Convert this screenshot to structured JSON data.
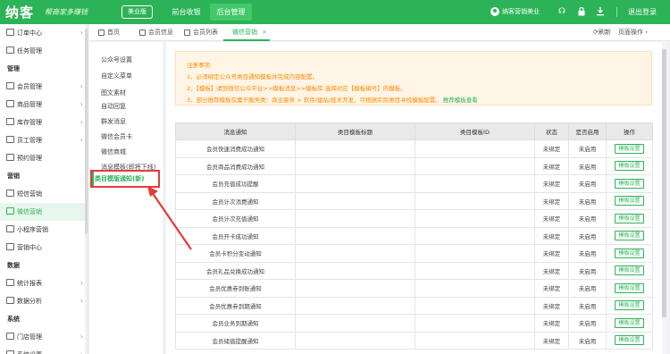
{
  "header": {
    "logo": "纳客",
    "slogan": "帮商家多赚钱",
    "edition": "美业版",
    "top_tabs": [
      "前台收银",
      "后台管理"
    ],
    "user": "纳客营销美业",
    "logout": "退出登录",
    "bg_color": "#2db357"
  },
  "sidebar": {
    "items": [
      {
        "type": "item",
        "label": "订单中心",
        "icon": "order-icon",
        "chev": "›"
      },
      {
        "type": "item",
        "label": "任务管理",
        "icon": "task-icon",
        "chev": ""
      },
      {
        "type": "group",
        "label": "管理"
      },
      {
        "type": "item",
        "label": "会员管理",
        "icon": "member-icon",
        "chev": "›"
      },
      {
        "type": "item",
        "label": "商品管理",
        "icon": "goods-icon",
        "chev": "›"
      },
      {
        "type": "item",
        "label": "库存管理",
        "icon": "stock-icon",
        "chev": "›"
      },
      {
        "type": "item",
        "label": "员工管理",
        "icon": "staff-icon",
        "chev": "›"
      },
      {
        "type": "item",
        "label": "预约管理",
        "icon": "booking-icon",
        "chev": ""
      },
      {
        "type": "group",
        "label": "营销"
      },
      {
        "type": "item",
        "label": "短信营销",
        "icon": "sms-icon",
        "chev": ""
      },
      {
        "type": "item",
        "label": "微信营销",
        "icon": "wechat-icon",
        "chev": "",
        "active": true
      },
      {
        "type": "item",
        "label": "小程序营销",
        "icon": "miniapp-icon",
        "chev": ""
      },
      {
        "type": "item",
        "label": "营销中心",
        "icon": "marketing-icon",
        "chev": ""
      },
      {
        "type": "group",
        "label": "数据"
      },
      {
        "type": "item",
        "label": "统计报表",
        "icon": "report-icon",
        "chev": "›"
      },
      {
        "type": "item",
        "label": "数据分析",
        "icon": "analysis-icon",
        "chev": "›"
      },
      {
        "type": "group",
        "label": "系统"
      },
      {
        "type": "item",
        "label": "门店管理",
        "icon": "store-icon",
        "chev": "›"
      },
      {
        "type": "item",
        "label": "系统设置",
        "icon": "settings-icon",
        "chev": "›"
      }
    ]
  },
  "tabs": {
    "items": [
      {
        "label": "首页"
      },
      {
        "label": "会员信息"
      },
      {
        "label": "会员列表"
      },
      {
        "label": "微信营销",
        "active": true
      }
    ],
    "refresh": "⟳刷新",
    "ops": "页面操作 ›"
  },
  "submenu": {
    "items": [
      "公众号设置",
      "自定义菜单",
      "图文素材",
      "自动回复",
      "群发消息",
      "微信会员卡",
      "微信商城",
      "消息模板(即将下线)"
    ],
    "active": "类目模版通知(新)"
  },
  "notice": {
    "title": "注意事项:",
    "line1": "1、必须绑定公众号类目通知模板并完成内容配置。",
    "line2": "2、【模板】请到微信公众平台>>模板消息>>模板库 选择对应【模板编号】的模板。",
    "line3": "3、部分推荐模板仅属于服务类：商业服务 > 软件/建站/技术开发，可根据实际类目寻找模板配置。",
    "link": "推荐模板查看"
  },
  "table": {
    "headers": [
      "消息通知",
      "类目模板标题",
      "类目模板ID",
      "状态",
      "是否启用",
      "操作"
    ],
    "rows": [
      [
        "会员快速消费成功通知",
        "",
        "",
        "未绑定",
        "未启用",
        "模板设置"
      ],
      [
        "会员商品消费成功通知",
        "",
        "",
        "未绑定",
        "未启用",
        "模板设置"
      ],
      [
        "会员充值成功提醒",
        "",
        "",
        "未绑定",
        "未启用",
        "模板设置"
      ],
      [
        "会员计次消费通知",
        "",
        "",
        "未绑定",
        "未启用",
        "模板设置"
      ],
      [
        "会员计次充值通知",
        "",
        "",
        "未绑定",
        "未启用",
        "模板设置"
      ],
      [
        "会员开卡成功通知",
        "",
        "",
        "未绑定",
        "未启用",
        "模板设置"
      ],
      [
        "会员卡积分变动通知",
        "",
        "",
        "未绑定",
        "未启用",
        "模板设置"
      ],
      [
        "会员礼品兑换成功通知",
        "",
        "",
        "未绑定",
        "未启用",
        "模板设置"
      ],
      [
        "会员优惠券到账通知",
        "",
        "",
        "未绑定",
        "未启用",
        "模板设置"
      ],
      [
        "会员优惠券到期通知",
        "",
        "",
        "未绑定",
        "未启用",
        "模板设置"
      ],
      [
        "会员业务到期通知",
        "",
        "",
        "未绑定",
        "未启用",
        "模板设置"
      ],
      [
        "会员储值提醒通知",
        "",
        "",
        "未绑定",
        "未启用",
        "模板设置"
      ]
    ]
  }
}
